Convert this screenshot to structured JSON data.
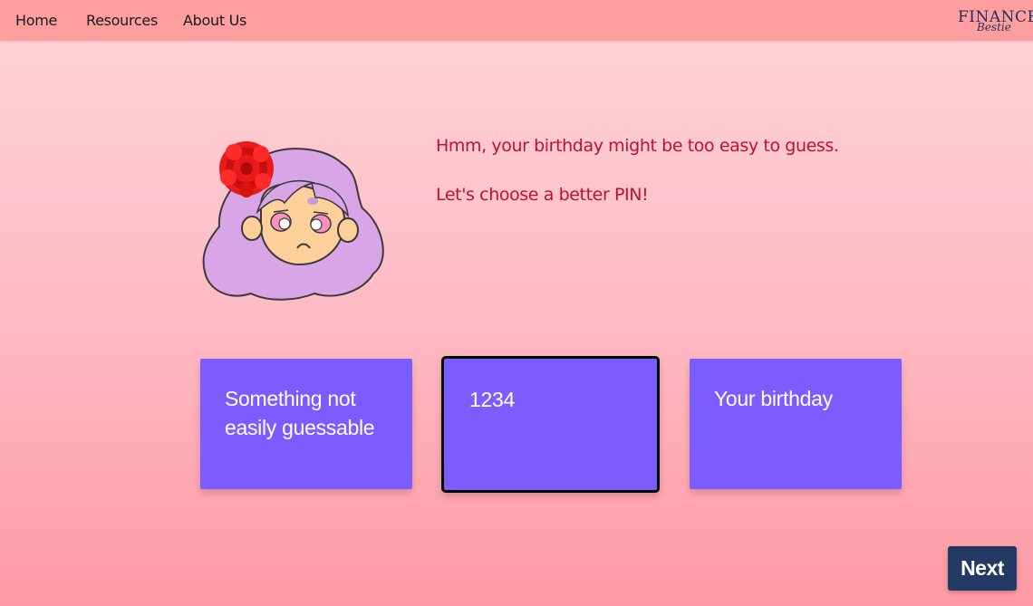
{
  "nav": {
    "links": [
      "Home",
      "Resources",
      "About Us"
    ],
    "logo": {
      "main": "FINANCE",
      "sub": "Bestie"
    }
  },
  "dialogue": {
    "line1": "Hmm, your birthday might be too easy to guess.",
    "line2": "Let's choose a better PIN!"
  },
  "choices": [
    {
      "label": "Something not easily guessable",
      "selected": false
    },
    {
      "label": "1234",
      "selected": true
    },
    {
      "label": "Your birthday",
      "selected": false
    }
  ],
  "next_button": {
    "label": "Next"
  },
  "colors": {
    "nav_bg": "#ff9e9e",
    "card_bg": "#7b5cff",
    "speech_text": "#c0102e",
    "next_bg": "#223a64",
    "logo": "#24305e"
  },
  "icons": {
    "avatar": "sad-girl-with-red-flower",
    "logo": "finance-bestie-logo"
  }
}
